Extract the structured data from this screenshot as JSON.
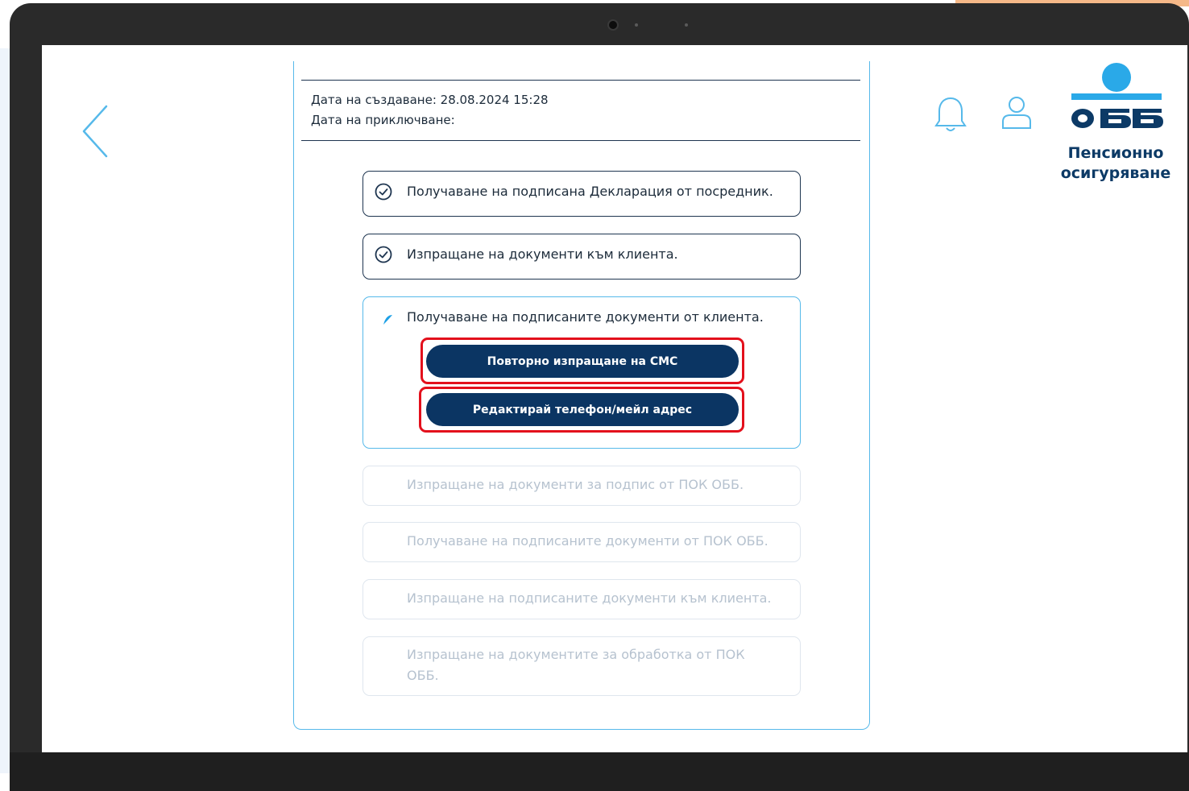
{
  "info": {
    "created": "Дата на създаване: 28.08.2024 15:28",
    "completed": "Дата на приключване:"
  },
  "logo": {
    "brand": "ОББ",
    "subtitle_line1": "Пенсионно",
    "subtitle_line2": "осигуряване"
  },
  "steps": [
    {
      "label": "Получаване на подписана Декларация от посредник.",
      "status": "done",
      "icon": "check-circle-icon"
    },
    {
      "label": "Изпращане на документи към клиента.",
      "status": "done",
      "icon": "check-circle-icon"
    },
    {
      "label": "Получаване на подписаните документи от клиента.",
      "status": "in-progress",
      "icon": "spinner-icon"
    },
    {
      "label": "Изпращане на документи за подпис от ПОК ОББ.",
      "status": "pending"
    },
    {
      "label": "Получаване на подписаните документи от ПОК ОББ.",
      "status": "pending"
    },
    {
      "label": "Изпращане на подписаните документи към клиента.",
      "status": "pending"
    },
    {
      "label": "Изпращане на документите за обработка от ПОК ОББ.",
      "status": "pending"
    }
  ],
  "actions": {
    "resend_sms": "Повторно изпращане на СМС",
    "edit_contact": "Редактирай телефон/мейл адрес"
  },
  "colors": {
    "brand_navy": "#0b3563",
    "accent_blue": "#56b9ea",
    "highlight_red": "#e3101c",
    "pending_text": "#b6c2cf"
  }
}
